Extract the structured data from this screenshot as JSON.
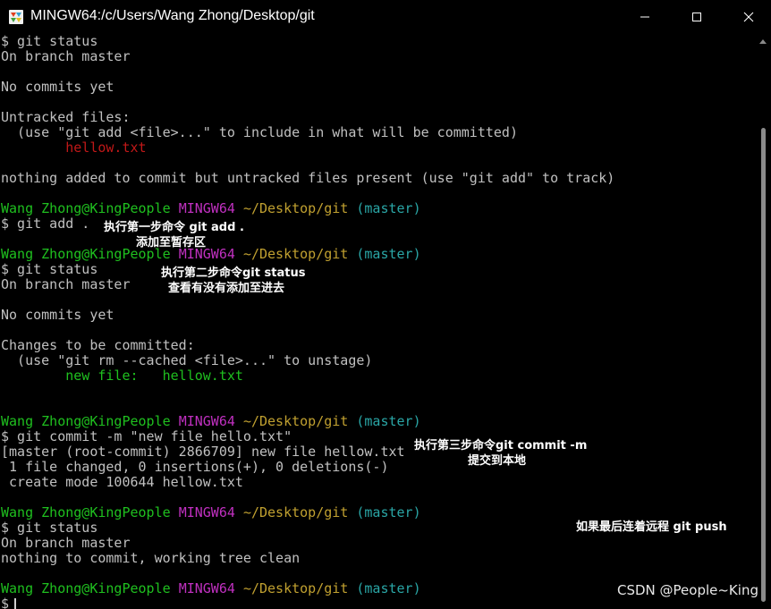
{
  "window": {
    "title": "MINGW64:/c/Users/Wang Zhong/Desktop/git",
    "minimize_label": "minimize",
    "maximize_label": "maximize",
    "close_label": "close"
  },
  "colors": {
    "green": "#1fc01f",
    "magenta": "#c030c0",
    "yellow": "#c0a030",
    "cyan": "#2aa6a6",
    "red": "#c01818",
    "text": "#c0c0c0",
    "background": "#000000"
  },
  "prompt": {
    "user_host": "Wang Zhong@KingPeople",
    "shell": "MINGW64",
    "path": "~/Desktop/git",
    "branch": "(master)"
  },
  "terminal": {
    "lines": [
      {
        "segments": [
          {
            "text": "$ git status",
            "color": "white"
          }
        ]
      },
      {
        "segments": [
          {
            "text": "On branch master",
            "color": "white"
          }
        ]
      },
      {
        "segments": [
          {
            "text": "",
            "color": "white"
          }
        ]
      },
      {
        "segments": [
          {
            "text": "No commits yet",
            "color": "white"
          }
        ]
      },
      {
        "segments": [
          {
            "text": "",
            "color": "white"
          }
        ]
      },
      {
        "segments": [
          {
            "text": "Untracked files:",
            "color": "white"
          }
        ]
      },
      {
        "segments": [
          {
            "text": "  (use \"git add <file>...\" to include in what will be committed)",
            "color": "white"
          }
        ]
      },
      {
        "segments": [
          {
            "text": "        ",
            "color": "white"
          },
          {
            "text": "hellow.txt",
            "color": "red"
          }
        ]
      },
      {
        "segments": [
          {
            "text": "",
            "color": "white"
          }
        ]
      },
      {
        "segments": [
          {
            "text": "nothing added to commit but untracked files present (use \"git add\" to track)",
            "color": "white"
          }
        ]
      },
      {
        "segments": [
          {
            "text": "",
            "color": "white"
          }
        ]
      },
      {
        "segments": [
          {
            "text": "Wang Zhong@KingPeople",
            "color": "green"
          },
          {
            "text": " ",
            "color": "white"
          },
          {
            "text": "MINGW64",
            "color": "magenta"
          },
          {
            "text": " ",
            "color": "white"
          },
          {
            "text": "~/Desktop/git",
            "color": "yellow"
          },
          {
            "text": " ",
            "color": "white"
          },
          {
            "text": "(master)",
            "color": "cyan"
          }
        ]
      },
      {
        "segments": [
          {
            "text": "$ git add .",
            "color": "white"
          }
        ]
      },
      {
        "segments": [
          {
            "text": "",
            "color": "white"
          }
        ]
      },
      {
        "segments": [
          {
            "text": "Wang Zhong@KingPeople",
            "color": "green"
          },
          {
            "text": " ",
            "color": "white"
          },
          {
            "text": "MINGW64",
            "color": "magenta"
          },
          {
            "text": " ",
            "color": "white"
          },
          {
            "text": "~/Desktop/git",
            "color": "yellow"
          },
          {
            "text": " ",
            "color": "white"
          },
          {
            "text": "(master)",
            "color": "cyan"
          }
        ]
      },
      {
        "segments": [
          {
            "text": "$ git status",
            "color": "white"
          }
        ]
      },
      {
        "segments": [
          {
            "text": "On branch master",
            "color": "white"
          }
        ]
      },
      {
        "segments": [
          {
            "text": "",
            "color": "white"
          }
        ]
      },
      {
        "segments": [
          {
            "text": "No commits yet",
            "color": "white"
          }
        ]
      },
      {
        "segments": [
          {
            "text": "",
            "color": "white"
          }
        ]
      },
      {
        "segments": [
          {
            "text": "Changes to be committed:",
            "color": "white"
          }
        ]
      },
      {
        "segments": [
          {
            "text": "  (use \"git rm --cached <file>...\" to unstage)",
            "color": "white"
          }
        ]
      },
      {
        "segments": [
          {
            "text": "        ",
            "color": "white"
          },
          {
            "text": "new file:   hellow.txt",
            "color": "green"
          }
        ]
      },
      {
        "segments": [
          {
            "text": "",
            "color": "white"
          }
        ]
      },
      {
        "segments": [
          {
            "text": "",
            "color": "white"
          }
        ]
      },
      {
        "segments": [
          {
            "text": "Wang Zhong@KingPeople",
            "color": "green"
          },
          {
            "text": " ",
            "color": "white"
          },
          {
            "text": "MINGW64",
            "color": "magenta"
          },
          {
            "text": " ",
            "color": "white"
          },
          {
            "text": "~/Desktop/git",
            "color": "yellow"
          },
          {
            "text": " ",
            "color": "white"
          },
          {
            "text": "(master)",
            "color": "cyan"
          }
        ]
      },
      {
        "segments": [
          {
            "text": "$ git commit -m \"new file hello.txt\"",
            "color": "white"
          }
        ]
      },
      {
        "segments": [
          {
            "text": "[master (root-commit) 2866709] new file hellow.txt",
            "color": "white"
          }
        ]
      },
      {
        "segments": [
          {
            "text": " 1 file changed, 0 insertions(+), 0 deletions(-)",
            "color": "white"
          }
        ]
      },
      {
        "segments": [
          {
            "text": " create mode 100644 hellow.txt",
            "color": "white"
          }
        ]
      },
      {
        "segments": [
          {
            "text": "",
            "color": "white"
          }
        ]
      },
      {
        "segments": [
          {
            "text": "Wang Zhong@KingPeople",
            "color": "green"
          },
          {
            "text": " ",
            "color": "white"
          },
          {
            "text": "MINGW64",
            "color": "magenta"
          },
          {
            "text": " ",
            "color": "white"
          },
          {
            "text": "~/Desktop/git",
            "color": "yellow"
          },
          {
            "text": " ",
            "color": "white"
          },
          {
            "text": "(master)",
            "color": "cyan"
          }
        ]
      },
      {
        "segments": [
          {
            "text": "$ git status",
            "color": "white"
          }
        ]
      },
      {
        "segments": [
          {
            "text": "On branch master",
            "color": "white"
          }
        ]
      },
      {
        "segments": [
          {
            "text": "nothing to commit, working tree clean",
            "color": "white"
          }
        ]
      },
      {
        "segments": [
          {
            "text": "",
            "color": "white"
          }
        ]
      },
      {
        "segments": [
          {
            "text": "Wang Zhong@KingPeople",
            "color": "green"
          },
          {
            "text": " ",
            "color": "white"
          },
          {
            "text": "MINGW64",
            "color": "magenta"
          },
          {
            "text": " ",
            "color": "white"
          },
          {
            "text": "~/Desktop/git",
            "color": "yellow"
          },
          {
            "text": " ",
            "color": "white"
          },
          {
            "text": "(master)",
            "color": "cyan"
          }
        ]
      },
      {
        "segments": [
          {
            "text": "$",
            "color": "white"
          }
        ],
        "cursor": true
      }
    ]
  },
  "annotations": {
    "step1_line1": "执行第一步命令 git add .",
    "step1_line2": "添加至暂存区",
    "step2_line1": "执行第二步命令git status",
    "step2_line2": "查看有没有添加至进去",
    "step3_line1": "执行第三步命令git commit -m",
    "step3_line2": "提交到本地",
    "step4_line1": "如果最后连着远程 git push"
  },
  "watermark": "CSDN @People~King"
}
